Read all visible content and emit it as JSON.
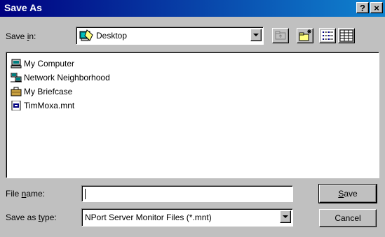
{
  "window": {
    "title": "Save As",
    "help_label": "?",
    "close_label": "×"
  },
  "save_in": {
    "label_pre": "Save ",
    "label_key": "i",
    "label_post": "n:",
    "value": "Desktop"
  },
  "files": [
    {
      "name": "My Computer",
      "icon": "computer-icon"
    },
    {
      "name": "Network Neighborhood",
      "icon": "network-icon"
    },
    {
      "name": "My Briefcase",
      "icon": "briefcase-icon"
    },
    {
      "name": "TimMoxa.mnt",
      "icon": "file-icon"
    }
  ],
  "file_name": {
    "label_pre": "File ",
    "label_key": "n",
    "label_post": "ame:",
    "value": ""
  },
  "save_as_type": {
    "label_pre": "Save as ",
    "label_key": "t",
    "label_post": "ype:",
    "value": "NPort Server Monitor Files (*.mnt)"
  },
  "buttons": {
    "save_key": "S",
    "save_rest": "ave",
    "cancel": "Cancel"
  }
}
